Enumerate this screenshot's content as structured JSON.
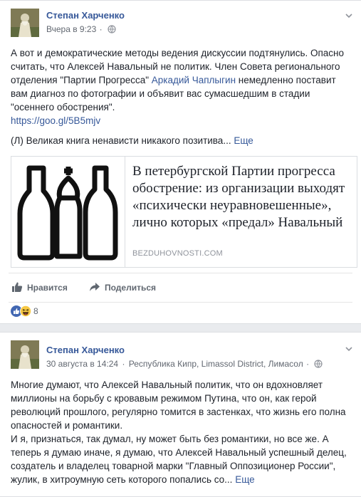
{
  "post1": {
    "author": "Степан Харченко",
    "timestamp": "Вчера в 9:23",
    "privacy_icon": "globe-icon",
    "text_before_link": "А вот и демократические методы ведения дискуссии подтянулись. Опасно считать, что Алексей Навальный не политик. Член Совета регионального отделения \"Партии Прогресса\" ",
    "mention": "Аркадий Чаплыгин",
    "text_after_link": " немедленно поставит вам диагноз по фотографии и объявит вас сумасшедшим в стадии \"осеннего обострения\".",
    "url": "https://goo.gl/5B5mjv",
    "extra_line": "(Л) Великая книга ненависти никакого позитива...",
    "more_label": "Еще",
    "preview": {
      "title": "В петербургской Партии прогресса обострение: из организации выходят «психически неуравновешенные», лично которых «предал» Навальный",
      "domain": "BEZDUHOVNOSTI.COM"
    },
    "actions": {
      "like": "Нравится",
      "share": "Поделиться"
    },
    "reactions_count": "8"
  },
  "post2": {
    "author": "Степан Харченко",
    "timestamp": "30 августа в 14:24",
    "location": "Республика Кипр, Limassol District, Лимасол",
    "paragraph1": "Многие думают, что Алексей Навальный политик, что он вдохновляет миллионы на борьбу с кровавым режимом Путина, что он, как герой революций прошлого, регулярно томится в застенках, что жизнь его полна опасностей и романтики.",
    "paragraph2": "И я, признаться, так думал, ну может быть без романтики, но все же. А теперь я думаю иначе, я думаю, что Алексей Навальный успешный делец, создатель и владелец товарной марки \"Главный Оппозиционер России\", жулик, в хитроумную сеть которого попались со...",
    "more_label": "Еще"
  },
  "colors": {
    "link": "#365899",
    "text": "#1d2129",
    "meta": "#616770",
    "background": "#e9ebee"
  }
}
